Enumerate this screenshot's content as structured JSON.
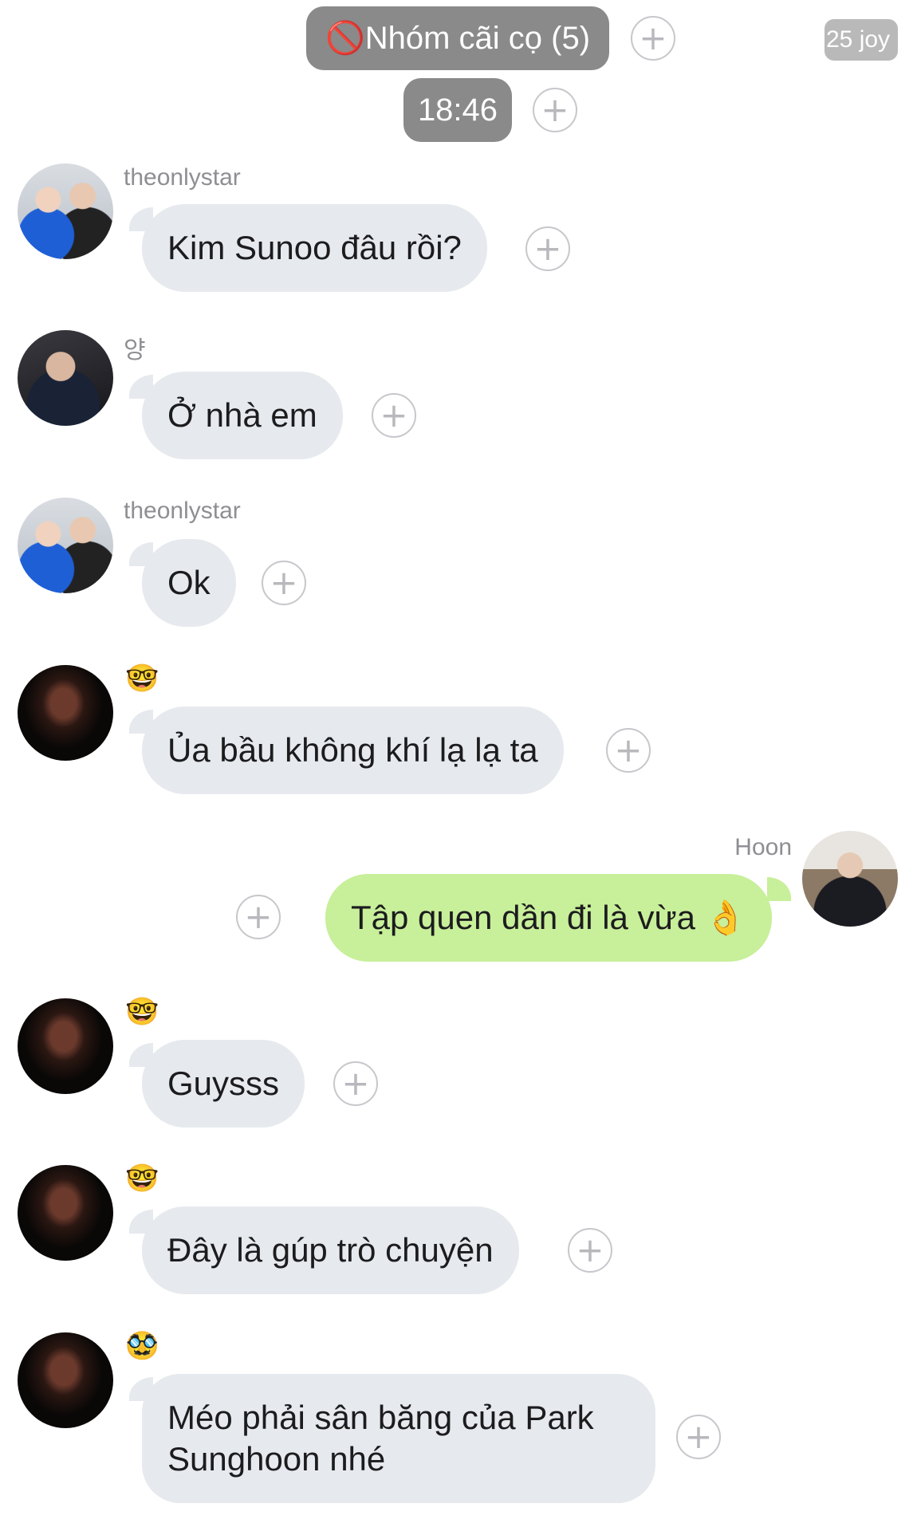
{
  "header": {
    "group_title": "🚫Nhóm cãi cọ (5)",
    "time": "18:46",
    "corner_stamp": "25 joy"
  },
  "plus_glyph": "+",
  "messages": [
    {
      "sender": "theonlystar",
      "text": "Kim Sunoo đâu rồi?",
      "avatar": "two-friends-selfie",
      "side": "left"
    },
    {
      "sender": "양",
      "text": "Ở nhà em",
      "avatar": "person-hand-sign",
      "side": "left"
    },
    {
      "sender": "theonlystar",
      "text": "Ok",
      "avatar": "two-friends-selfie",
      "side": "left"
    },
    {
      "sender": "🤓",
      "text": "Ủa bầu không khí lạ lạ ta",
      "avatar": "dark-portrait",
      "side": "left"
    },
    {
      "sender": "Hoon",
      "text": "Tập quen dần đi là vừa 👌",
      "avatar": "person-uniform",
      "side": "right"
    },
    {
      "sender": "🤓",
      "text": "Guysss",
      "avatar": "dark-portrait",
      "side": "left"
    },
    {
      "sender": "🤓",
      "text": "Đây là gúp trò chuyện",
      "avatar": "dark-portrait",
      "side": "left"
    },
    {
      "sender": "🥸",
      "text": "Méo phải sân băng của Park Sunghoon nhé",
      "avatar": "dark-portrait",
      "side": "left"
    }
  ],
  "colors": {
    "incoming_bubble": "#e6e9ed",
    "outgoing_bubble": "#c8ef9a",
    "header_pill": "#8a8a8a",
    "sender_name": "#8e8e93"
  },
  "icons": [
    "plus-circle-icon",
    "no-entry-icon"
  ]
}
